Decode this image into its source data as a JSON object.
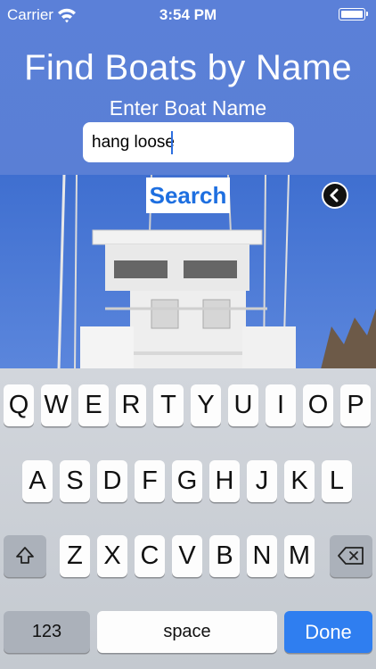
{
  "status_bar": {
    "carrier": "Carrier",
    "time": "3:54 PM"
  },
  "header": {
    "title": "Find Boats by Name",
    "field_label": "Enter Boat Name"
  },
  "search": {
    "value": "hang loose",
    "button_label": "Search"
  },
  "keyboard": {
    "row1": [
      "Q",
      "W",
      "E",
      "R",
      "T",
      "Y",
      "U",
      "I",
      "O",
      "P"
    ],
    "row2": [
      "A",
      "S",
      "D",
      "F",
      "G",
      "H",
      "J",
      "K",
      "L"
    ],
    "row3": [
      "Z",
      "X",
      "C",
      "V",
      "B",
      "N",
      "M"
    ],
    "numbers_key": "123",
    "space_key": "space",
    "done_key": "Done"
  },
  "colors": {
    "header_bg": "#5a7fd6",
    "search_text": "#1e6fe0",
    "done_key": "#2f7ef0"
  },
  "icons": {
    "wifi": "wifi-icon",
    "battery": "battery-icon",
    "back": "chevron-left-icon",
    "shift": "shift-icon",
    "delete": "backspace-icon"
  }
}
